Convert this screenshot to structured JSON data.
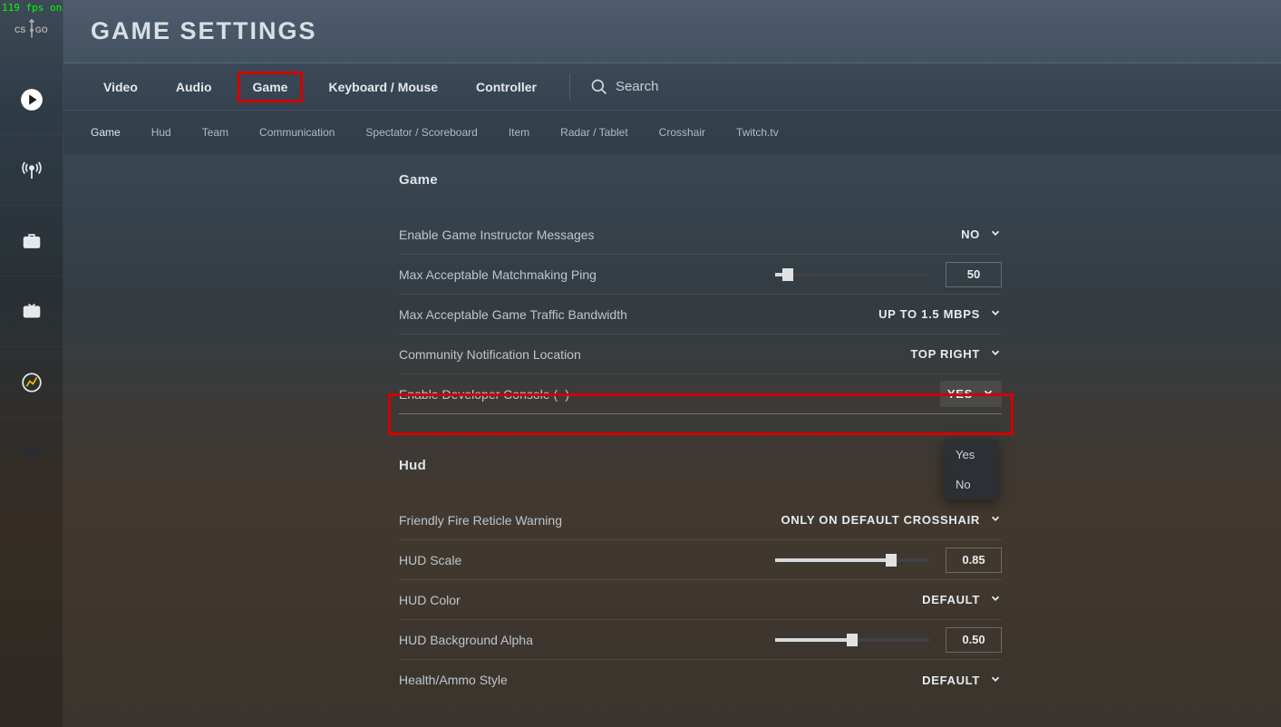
{
  "fps": "119 fps on",
  "logo": {
    "left": "CS",
    "right": "GO"
  },
  "page_title": "GAME SETTINGS",
  "primary_tabs": {
    "video": "Video",
    "audio": "Audio",
    "game": "Game",
    "keyboard": "Keyboard / Mouse",
    "controller": "Controller",
    "active": "game"
  },
  "search": {
    "placeholder": "Search"
  },
  "sub_tabs": {
    "game": "Game",
    "hud": "Hud",
    "team": "Team",
    "communication": "Communication",
    "spectator": "Spectator / Scoreboard",
    "item": "Item",
    "radar": "Radar / Tablet",
    "crosshair": "Crosshair",
    "twitch": "Twitch.tv",
    "active": "game"
  },
  "sections": {
    "game": {
      "title": "Game",
      "rows": {
        "instructor": {
          "label": "Enable Game Instructor Messages",
          "value": "NO"
        },
        "ping": {
          "label": "Max Acceptable Matchmaking Ping",
          "value": "50",
          "slider_pct": 8
        },
        "bandwidth": {
          "label": "Max Acceptable Game Traffic Bandwidth",
          "value": "UP TO 1.5 MBPS"
        },
        "notif": {
          "label": "Community Notification Location",
          "value": "TOP RIGHT"
        },
        "devconsole": {
          "label": "Enable Developer Console (~)",
          "value": "YES",
          "options": {
            "yes": "Yes",
            "no": "No"
          }
        }
      }
    },
    "hud": {
      "title": "Hud",
      "rows": {
        "ffwarn": {
          "label": "Friendly Fire Reticle Warning",
          "value": "ONLY ON DEFAULT CROSSHAIR"
        },
        "hudscale": {
          "label": "HUD Scale",
          "value": "0.85",
          "slider_pct": 75
        },
        "hudcolor": {
          "label": "HUD Color",
          "value": "DEFAULT"
        },
        "hudalpha": {
          "label": "HUD Background Alpha",
          "value": "0.50",
          "slider_pct": 50
        },
        "health": {
          "label": "Health/Ammo Style",
          "value": "DEFAULT"
        }
      }
    }
  }
}
